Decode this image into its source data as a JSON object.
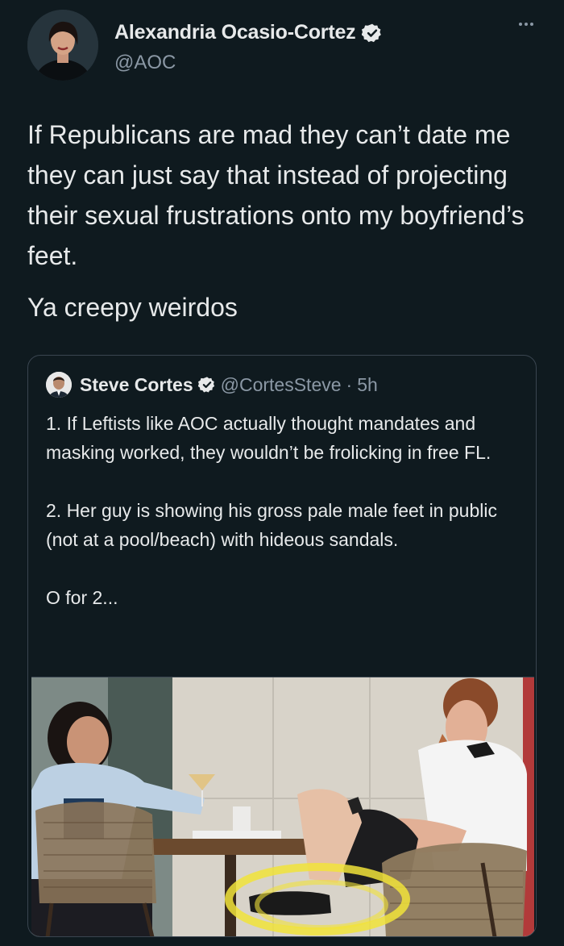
{
  "author": {
    "name": "Alexandria Ocasio-Cortez",
    "handle": "@AOC",
    "verified": true
  },
  "tweet": {
    "paragraphs": [
      "If Republicans are mad they can’t date me they can just say that instead of projecting their sexual frustrations onto my boyfriend’s feet.",
      "Ya creepy weirdos"
    ]
  },
  "quoted_tweet": {
    "name": "Steve Cortes",
    "handle": "@CortesSteve",
    "separator": "·",
    "time": "5h",
    "verified": true,
    "paragraphs": [
      "1. If Leftists like AOC actually thought mandates and masking worked, they wouldn’t be frolicking in free FL.",
      "2. Her guy is showing his gross pale male feet in public (not at a pool/beach) with hideous sandals.",
      "O for 2..."
    ]
  },
  "icons": {
    "verified": "verified-badge-icon",
    "more": "more-options-icon"
  },
  "colors": {
    "background": "#0f1a1f",
    "text": "#e7e9ea",
    "secondary": "#8b98a5",
    "verified": "#e7e9ea",
    "highlight_circle": "#f1e33a"
  }
}
